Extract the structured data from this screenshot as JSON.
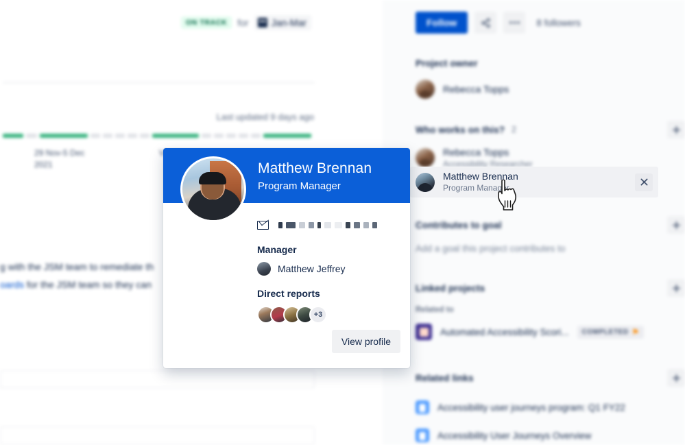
{
  "left_pane": {
    "status_pill": "ON TRACK",
    "status_for": "for",
    "date_range": "Jan-Mar",
    "last_updated": "Last updated 9 days ago",
    "timeline_label_1": "29 Nov-5 Dec",
    "timeline_label_1b": "2021",
    "timeline_label_2": "V",
    "body_line_1": "g with the JSM team to remediate th",
    "body_line_2_link": "oards",
    "body_line_2": " for the JSM team so they can",
    "timeline_segments": [
      {
        "w": 30,
        "c": "green"
      },
      {
        "w": 16,
        "c": "grey"
      },
      {
        "w": 70,
        "c": "green"
      },
      {
        "w": 14,
        "c": "grey"
      },
      {
        "w": 14,
        "c": "grey"
      },
      {
        "w": 14,
        "c": "grey"
      },
      {
        "w": 14,
        "c": "grey"
      },
      {
        "w": 14,
        "c": "grey"
      },
      {
        "w": 68,
        "c": "green"
      },
      {
        "w": 14,
        "c": "grey"
      },
      {
        "w": 14,
        "c": "grey"
      },
      {
        "w": 14,
        "c": "grey"
      },
      {
        "w": 14,
        "c": "grey"
      },
      {
        "w": 14,
        "c": "grey"
      },
      {
        "w": 70,
        "c": "green"
      }
    ]
  },
  "sidebar": {
    "follow_label": "Follow",
    "share_icon": "share-icon",
    "more_icon": "more-icon",
    "followers": "8 followers",
    "project_owner_heading": "Project owner",
    "project_owner_name": "Rebecca Topps",
    "who_works_heading": "Who works on this?",
    "who_works_count": "2",
    "add_icon": "plus-icon",
    "people": [
      {
        "name": "Rebecca Topps",
        "role": "Accessibility Researcher",
        "avatar": "rebecca",
        "highlighted": false
      },
      {
        "name": "Matthew Brennan",
        "role": "Program Manager",
        "avatar": "matthew",
        "highlighted": true
      }
    ],
    "remove_icon": "close-icon",
    "contributes_heading": "Contributes to goal",
    "contributes_empty": "Add a goal this project contributes to",
    "linked_projects_heading": "Linked projects",
    "related_to_label": "Related to",
    "linked_project_title": "Automated Accessibility Scori...",
    "linked_project_status": "COMPLETED",
    "linked_project_flag": "⚑",
    "related_links_heading": "Related links",
    "related_links": [
      "Accessibility user journeys program: Q1 FY22",
      "Accessibility User Journeys Overview"
    ]
  },
  "profile_card": {
    "name": "Matthew Brennan",
    "role": "Program Manager",
    "email_icon": "mail-icon",
    "email_redacted": true,
    "manager_heading": "Manager",
    "manager_name": "Matthew Jeffrey",
    "direct_reports_heading": "Direct reports",
    "direct_reports_overflow": "+3",
    "view_profile_label": "View profile",
    "direct_reports": [
      {
        "gradient": "linear-gradient(160deg,#e3d9cf 0%,#9c7a5c 40%,#2f3640 100%)"
      },
      {
        "gradient": "linear-gradient(160deg,#8e5a49 0%,#b33a4a 55%,#2b2f38 100%)"
      },
      {
        "gradient": "linear-gradient(160deg,#d7c39a 0%,#8b7243 50%,#403524 100%)"
      },
      {
        "gradient": "linear-gradient(160deg,#7e8b78 0%,#3d4a42 50%,#1d2128 100%)"
      }
    ],
    "email_blocks": [
      {
        "w": 6,
        "c": "#2f3b4d"
      },
      {
        "w": 14,
        "c": "#4a5668"
      },
      {
        "w": 9,
        "c": "#c9ced6"
      },
      {
        "w": 8,
        "c": "#8d97a6"
      },
      {
        "w": 5,
        "c": "#38424f"
      },
      {
        "w": 10,
        "c": "#e2e5ea"
      },
      {
        "w": 11,
        "c": "#eceef1"
      },
      {
        "w": 7,
        "c": "#3a4553"
      },
      {
        "w": 9,
        "c": "#6a7585"
      },
      {
        "w": 8,
        "c": "#aab2bd"
      },
      {
        "w": 7,
        "c": "#5c6777"
      }
    ]
  },
  "colors": {
    "brand_blue": "#0052cc",
    "banner_blue": "#0b5fd8",
    "green": "#36b37e",
    "panel_bg": "#fafbfc",
    "text": "#172b4d",
    "muted": "#6b778c"
  }
}
